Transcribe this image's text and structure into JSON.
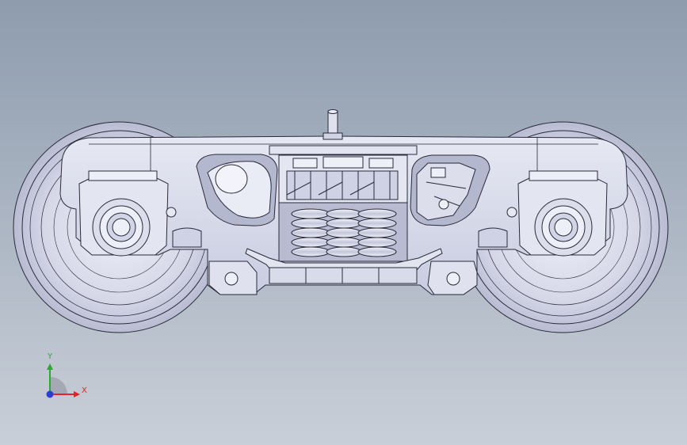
{
  "viewport": {
    "background_top": "#8e9cae",
    "background_bottom": "#c9cfd8"
  },
  "model": {
    "part_color": "#d9dbea",
    "edge_color": "#2a2a3a",
    "shade_color": "#b7bad0"
  },
  "triad": {
    "x_label": "X",
    "y_label": "Y",
    "x_color": "#e0242a",
    "y_color": "#2ea832",
    "z_color": "#2b3fd8"
  }
}
